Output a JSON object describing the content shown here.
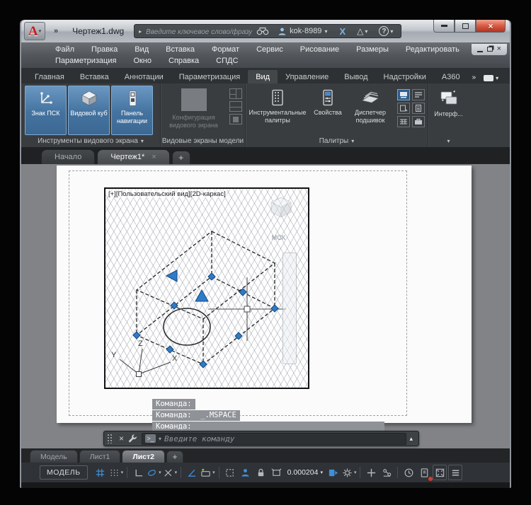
{
  "icons": {
    "caret_down": "▾",
    "caret_up": "▴",
    "caret_right": "▸",
    "overflow": "»",
    "close": "×",
    "plus": "+",
    "help": "?",
    "exchange": "X",
    "a360_triangle": "△",
    "prompt": ">_"
  },
  "title_bar": {
    "app_logo": "A",
    "doc_title": "Чертеж1.dwg",
    "search_placeholder": "Введите ключевое слово/фразу",
    "username": "kok-8989"
  },
  "menu": {
    "row1": [
      "Файл",
      "Правка",
      "Вид",
      "Вставка",
      "Формат",
      "Сервис",
      "Рисование",
      "Размеры",
      "Редактировать"
    ],
    "row2": [
      "Параметризация",
      "Окно",
      "Справка",
      "СПДС"
    ]
  },
  "ribbon": {
    "tabs": [
      "Главная",
      "Вставка",
      "Аннотации",
      "Параметризация",
      "Вид",
      "Управление",
      "Вывод",
      "Надстройки",
      "A360"
    ],
    "active_tab": "Вид",
    "panels": {
      "viewport_tools": {
        "label": "Инструменты видового экрана",
        "buttons": [
          "Знак ПСК",
          "Видовой куб",
          "Панель навигации"
        ]
      },
      "model_viewports": {
        "label": "Видовые экраны модели",
        "config_button": "Конфигурация видового экрана"
      },
      "palettes": {
        "label": "Палитры",
        "buttons": [
          "Инструментальные палитры",
          "Свойства",
          "Диспетчер подшивок"
        ]
      },
      "interface": {
        "label": "Интерф..."
      }
    }
  },
  "doc_tabs": {
    "items": [
      "Начало",
      "Чертеж1*"
    ]
  },
  "drawing": {
    "viewport_label": "[+][Пользовательский вид][2D-каркас]",
    "viewcube_label": "МСК",
    "axis_x": "X",
    "axis_y": "Y",
    "axis_z": "Z"
  },
  "command": {
    "history": [
      "Команда:",
      "Команда:  _.MSPACE",
      "Команда:"
    ],
    "placeholder": "Введите команду"
  },
  "layout_tabs": {
    "items": [
      "Модель",
      "Лист1",
      "Лист2"
    ]
  },
  "status_bar": {
    "model_label": "МОДЕЛЬ",
    "annotation_scale": "0.000204"
  }
}
